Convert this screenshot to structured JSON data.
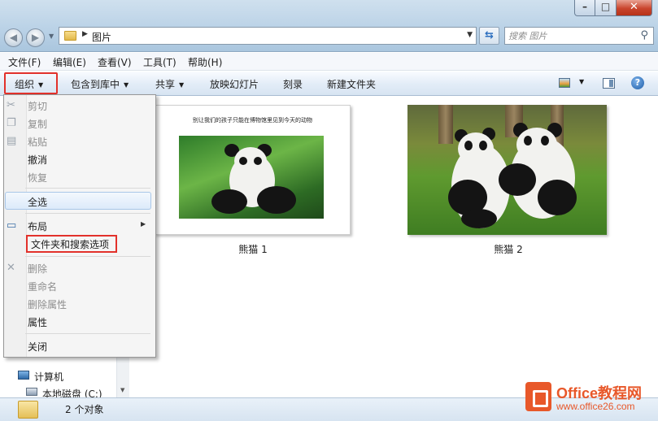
{
  "address": {
    "path": "图片",
    "search_placeholder": "搜索 图片"
  },
  "menubar": [
    "文件(F)",
    "编辑(E)",
    "查看(V)",
    "工具(T)",
    "帮助(H)"
  ],
  "toolbar": {
    "organize": "组织",
    "include_library": "包含到库中",
    "share": "共享",
    "slideshow": "放映幻灯片",
    "burn": "刻录",
    "new_folder": "新建文件夹"
  },
  "organize_menu": {
    "cut": "剪切",
    "copy": "复制",
    "paste": "粘贴",
    "undo": "撤消",
    "redo": "恢复",
    "select_all": "全选",
    "layout": "布局",
    "folder_options": "文件夹和搜索选项",
    "delete": "删除",
    "rename": "重命名",
    "remove_props": "删除属性",
    "properties": "属性",
    "close": "关闭"
  },
  "nav_pane": {
    "computer": "计算机",
    "local_disk": "本地磁盘 (C:)"
  },
  "files": [
    {
      "name": "熊猫 1",
      "image_caption": "别让我们的孩子只能在博物馆里见到今天的动物"
    },
    {
      "name": "熊猫 2"
    }
  ],
  "status": {
    "count": "2 个对象"
  },
  "watermark": {
    "title": "Office教程网",
    "url": "www.office26.com"
  },
  "colors": {
    "highlight": "#e2312b",
    "watermark": "#e8582a"
  }
}
